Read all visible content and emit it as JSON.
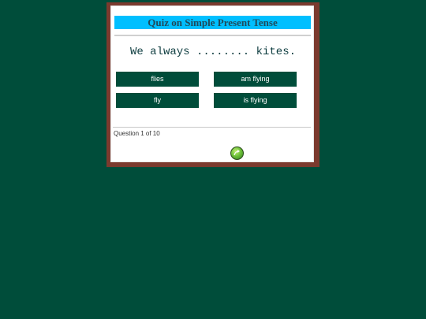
{
  "quiz": {
    "title": "Quiz on Simple Present Tense",
    "question": "We always ........ kites.",
    "answers": [
      "flies",
      "am flying",
      "fly",
      "is flying"
    ],
    "progress": "Question 1 of 10",
    "next_icon": "next-arrow-icon"
  },
  "colors": {
    "background": "#004d3a",
    "frame": "#7b3a2e",
    "title_bar": "#00bfff",
    "answer_button": "#004d3a"
  }
}
